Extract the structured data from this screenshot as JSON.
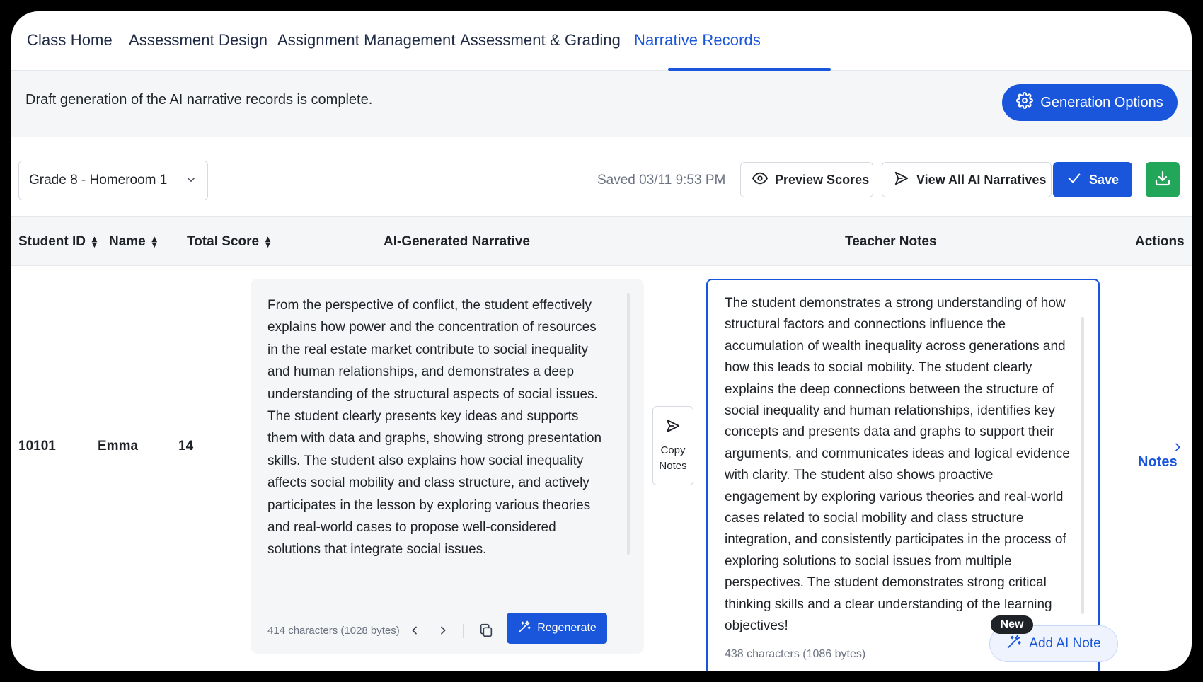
{
  "tabs": [
    {
      "label": "Class Home"
    },
    {
      "label": "Assessment Design"
    },
    {
      "label": "Assignment Management"
    },
    {
      "label": "Assessment & Grading"
    },
    {
      "label": "Narrative Records",
      "active": true
    }
  ],
  "banner": {
    "message": "Draft generation of the AI narrative records is complete.",
    "generation_options_label": "Generation Options"
  },
  "toolbar": {
    "class_select_value": "Grade 8 - Homeroom 1",
    "saved_status": "Saved 03/11 9:53 PM",
    "preview_scores_label": "Preview Scores",
    "view_all_label": "View All AI Narratives",
    "save_label": "Save"
  },
  "table": {
    "headers": {
      "student_id": "Student ID",
      "name": "Name",
      "total_score": "Total Score",
      "ai_narrative": "AI-Generated Narrative",
      "teacher_notes": "Teacher Notes",
      "actions": "Actions"
    },
    "rows": [
      {
        "student_id": "10101",
        "name": "Emma",
        "total_score": "14",
        "ai_narrative": "From the perspective of conflict, the student effectively explains how power and the concentration of resources in the real estate market contribute to social inequality and human relationships, and demonstrates a deep understanding of the structural aspects of social issues. The student clearly presents key ideas and supports them with data and graphs, showing strong presentation skills. The student also explains how social inequality affects social mobility and class structure, and actively participates in the lesson by exploring various theories and real-world cases to propose well-considered solutions that integrate social issues.",
        "ai_char_count": "414 characters (1028 bytes)",
        "regenerate_label": "Regenerate",
        "copy_notes_label_1": "Copy",
        "copy_notes_label_2": "Notes",
        "teacher_notes": "The student demonstrates a strong understanding of how structural factors and connections influence the accumulation of wealth inequality across generations and how this leads to social mobility. The student clearly explains the deep connections between the structure of social inequality and human relationships, identifies key concepts and presents data and graphs to support their arguments, and communicates ideas and logical evidence with clarity. The student also shows proactive engagement by exploring various theories and real-world cases related to social mobility and class structure integration, and consistently participates in the process of exploring solutions to social issues from multiple perspectives. The student demonstrates strong critical thinking skills and a clear understanding of the learning objectives!",
        "notes_char_count": "438 characters (1086 bytes)",
        "add_ai_note_label": "Add AI Note",
        "new_badge": "New",
        "actions_label": "Notes"
      }
    ]
  },
  "colors": {
    "accent": "#1a56db",
    "download": "#22a659",
    "header_bg": "#f5f6f8"
  }
}
